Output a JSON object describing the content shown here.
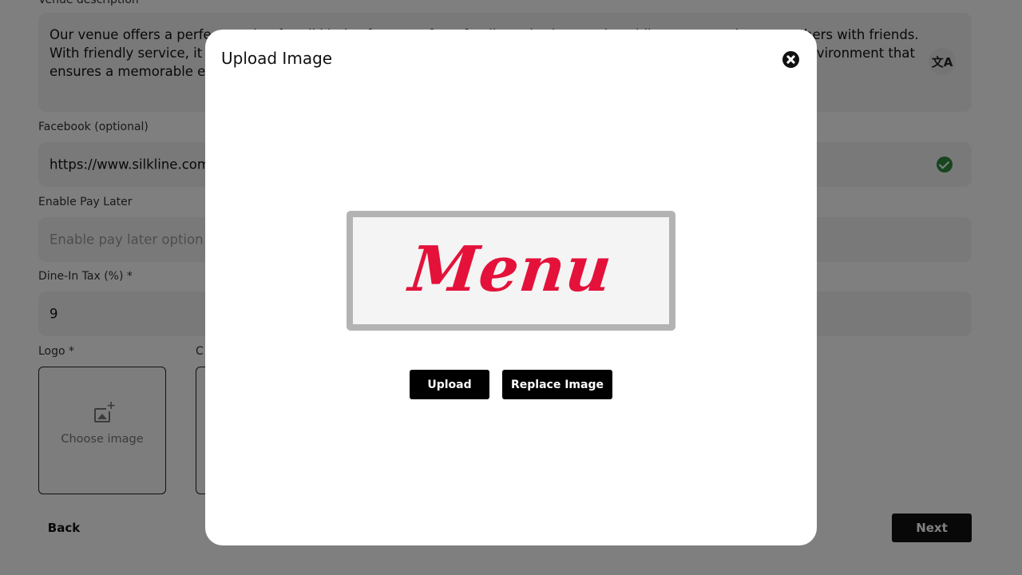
{
  "form": {
    "venue_description": {
      "label": "Venue description",
      "value": "Our venue offers a perfect setting for all kinds of events, from family gatherings and weddings to casual get-togethers with friends. With friendly service, it provides a welcoming atmosphere and a menu to satisfy every taste, all in a comfortable environment that ensures a memorable experience."
    },
    "facebook": {
      "label": "Facebook (optional)",
      "value": "https://www.silkline.com",
      "status_icon": "check-circle-icon"
    },
    "pay_later": {
      "label": "Enable Pay Later",
      "placeholder": "Enable pay later option f"
    },
    "dine_in_tax": {
      "label": "Dine-In Tax (%) *",
      "value": "9"
    },
    "logo": {
      "label": "Logo *",
      "tile_text": "Choose image",
      "icon": "add-image-icon"
    },
    "cover": {
      "label": "C"
    },
    "back_label": "Back",
    "next_label": "Next"
  },
  "modal": {
    "title": "Upload Image",
    "close_icon": "close-icon",
    "preview_text": "Menu",
    "upload_label": "Upload",
    "replace_label": "Replace Image"
  },
  "colors": {
    "overlay": "rgba(0,0,0,0.5)",
    "primary_button": "#000000",
    "success": "#2e8b3e",
    "preview_accent": "#e4123a"
  }
}
